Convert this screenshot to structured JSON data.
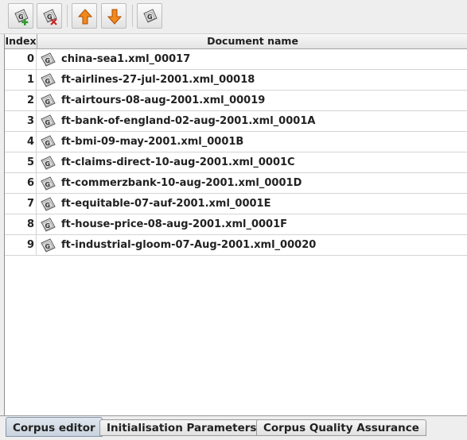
{
  "toolbar": {
    "buttons": [
      {
        "name": "add-document-button",
        "icon": "gate-document-add-icon"
      },
      {
        "name": "remove-document-button",
        "icon": "gate-document-remove-icon"
      },
      {
        "name": "move-up-button",
        "icon": "arrow-up-icon"
      },
      {
        "name": "move-down-button",
        "icon": "arrow-down-icon"
      },
      {
        "name": "open-document-button",
        "icon": "gate-document-icon"
      }
    ],
    "colors": {
      "arrow": "#e06a00",
      "add": "#2b9a2b",
      "remove": "#cc2222"
    }
  },
  "table": {
    "headers": {
      "index": "Index",
      "document": "Document name"
    },
    "rows": [
      {
        "index": "0",
        "name": "china-sea1.xml_00017"
      },
      {
        "index": "1",
        "name": "ft-airlines-27-jul-2001.xml_00018"
      },
      {
        "index": "2",
        "name": "ft-airtours-08-aug-2001.xml_00019"
      },
      {
        "index": "3",
        "name": "ft-bank-of-england-02-aug-2001.xml_0001A"
      },
      {
        "index": "4",
        "name": "ft-bmi-09-may-2001.xml_0001B"
      },
      {
        "index": "5",
        "name": "ft-claims-direct-10-aug-2001.xml_0001C"
      },
      {
        "index": "6",
        "name": "ft-commerzbank-10-aug-2001.xml_0001D"
      },
      {
        "index": "7",
        "name": "ft-equitable-07-auf-2001.xml_0001E"
      },
      {
        "index": "8",
        "name": "ft-house-price-08-aug-2001.xml_0001F"
      },
      {
        "index": "9",
        "name": "ft-industrial-gloom-07-Aug-2001.xml_00020"
      }
    ]
  },
  "tabs": [
    {
      "label": "Corpus editor",
      "active": true
    },
    {
      "label": "Initialisation Parameters",
      "active": false
    },
    {
      "label": "Corpus Quality Assurance",
      "active": false
    }
  ]
}
